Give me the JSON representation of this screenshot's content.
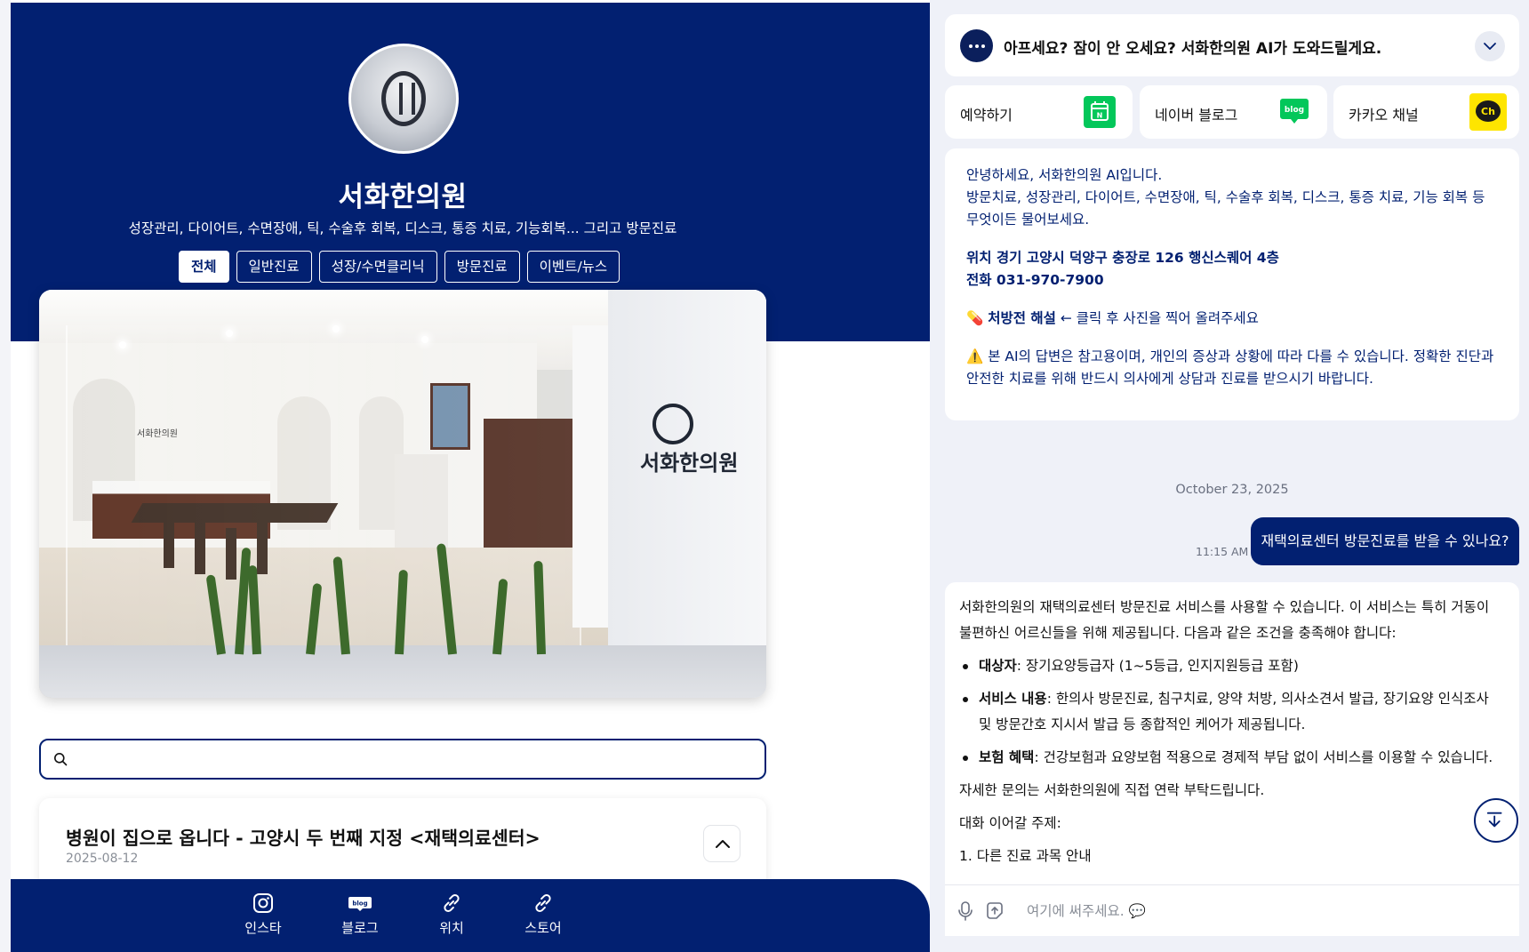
{
  "profile": {
    "name": "서화한의원",
    "subtitle": "성장관리, 다이어트, 수면장애, 틱, 수술후 회복, 디스크, 통증 치료, 기능회복... 그리고 방문진료",
    "photo_sign": "서화한의원",
    "photo_small_sign": "서화한의원"
  },
  "tabs": [
    {
      "label": "전체",
      "active": true
    },
    {
      "label": "일반진료",
      "active": false
    },
    {
      "label": "성장/수면클리닉",
      "active": false
    },
    {
      "label": "방문진료",
      "active": false
    },
    {
      "label": "이벤트/뉴스",
      "active": false
    }
  ],
  "search": {
    "value": "",
    "placeholder": ""
  },
  "post": {
    "title": "병원이 집으로 옵니다 - 고양시 두 번째 지정 <재택의료센터>",
    "date": "2025-08-12"
  },
  "bottom_nav": [
    {
      "label": "인스타",
      "icon": "instagram-icon"
    },
    {
      "label": "블로그",
      "icon": "blog-icon"
    },
    {
      "label": "위치",
      "icon": "link-icon"
    },
    {
      "label": "스토어",
      "icon": "link-icon"
    }
  ],
  "chat": {
    "header": "아프세요? 잠이 안 오세요? 서화한의원 AI가 도와드릴게요.",
    "quick_links": [
      {
        "label": "예약하기",
        "icon": "naver-booking-icon",
        "color": "#03c75a"
      },
      {
        "label": "네이버 블로그",
        "icon": "naver-blog-icon",
        "color": "#03c75a"
      },
      {
        "label": "카카오 채널",
        "icon": "kakao-channel-icon",
        "color": "#fee500"
      }
    ],
    "welcome": {
      "line1": "안녕하세요, 서화한의원 AI입니다.",
      "line2": "방문치료, 성장관리, 다이어트, 수면장애, 틱, 수술후 회복, 디스크, 통증 치료, 기능 회복 등 무엇이든 물어보세요.",
      "location": "위치 경기 고양시 덕양구 충장로 126 행신스퀘어 4층",
      "phone": "전화 031-970-7900",
      "prescription_emoji": "💊",
      "prescription_bold": "처방전 해설",
      "prescription_rest": " ← 클릭 후 사진을 찍어 올려주세요",
      "warning_emoji": "⚠️",
      "warning": " 본 AI의 답변은 참고용이며, 개인의 증상과 상황에 따라 다를 수 있습니다. 정확한 진단과 안전한 치료를 위해 반드시 의사에게 상담과 진료를 받으시기 바랍니다."
    },
    "date": "October 23, 2025",
    "user_message": "재택의료센터 방문진료를 받을 수 있나요?",
    "user_time": "11:15 AM",
    "answer": {
      "intro": "서화한의원의 재택의료센터 방문진료 서비스를 사용할 수 있습니다. 이 서비스는 특히 거동이 불편하신 어르신들을 위해 제공됩니다. 다음과 같은 조건을 충족해야 합니다:",
      "items": [
        {
          "term": "대상자",
          "text": ": 장기요양등급자 (1~5등급, 인지지원등급 포함)"
        },
        {
          "term": "서비스 내용",
          "text": ": 한의사 방문진료, 침구치료, 양약 처방, 의사소견서 발급, 장기요양 인식조사 및 방문간호 지시서 발급 등 종합적인 케어가 제공됩니다."
        },
        {
          "term": "보험 혜택",
          "text": ": 건강보험과 요양보험 적용으로 경제적 부담 없이 서비스를 이용할 수 있습니다."
        }
      ],
      "closing": "자세한 문의는 서화한의원에 직접 연락 부탁드립니다.",
      "followup_label": "대화 이어갈 주제:",
      "followup_1": "1. 다른 진료 과목 안내"
    },
    "composer": {
      "value": "",
      "placeholder": "여기에 써주세요. 💬"
    }
  },
  "colors": {
    "brand_navy": "#022071",
    "naver_green": "#03c75a",
    "kakao_yellow": "#fee500"
  }
}
